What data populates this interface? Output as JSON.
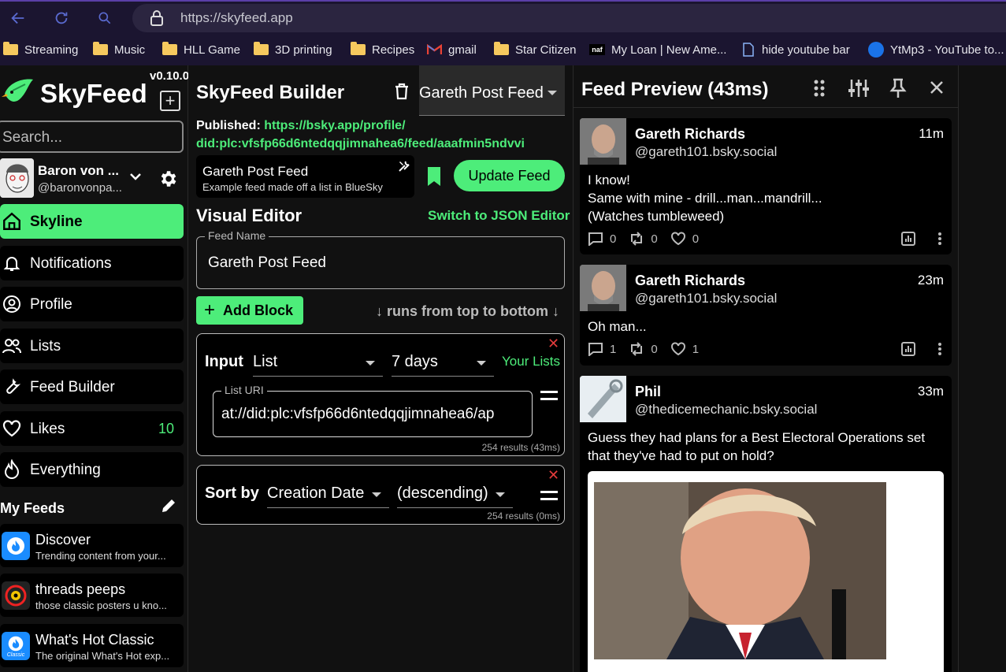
{
  "browser": {
    "url": "https://skyfeed.app",
    "bookmarks": [
      "Streaming",
      "Music",
      "HLL Game",
      "3D printing",
      "Recipes",
      "gmail",
      "Star Citizen",
      "My Loan | New Ame...",
      "hide youtube bar",
      "YtMp3 - YouTube to..."
    ]
  },
  "sidebar": {
    "app_name": "SkyFeed",
    "version": "v0.10.0",
    "search_placeholder": "Search...",
    "user": {
      "name": "Baron von ...",
      "handle": "@baronvonpa..."
    },
    "nav": [
      {
        "label": "Skyline",
        "icon": "home-icon"
      },
      {
        "label": "Notifications",
        "icon": "bell-icon"
      },
      {
        "label": "Profile",
        "icon": "user-circle-icon"
      },
      {
        "label": "Lists",
        "icon": "people-icon"
      },
      {
        "label": "Feed Builder",
        "icon": "wrench-icon"
      },
      {
        "label": "Likes",
        "icon": "heart-icon",
        "count": "10"
      },
      {
        "label": "Everything",
        "icon": "flame-icon"
      }
    ],
    "my_feeds_label": "My Feeds",
    "feeds": [
      {
        "title": "Discover",
        "subtitle": "Trending content from your..."
      },
      {
        "title": "threads peeps",
        "subtitle": "those classic posters u kno..."
      },
      {
        "title": "What's Hot Classic",
        "subtitle": "The original What's Hot exp...",
        "badge": "Classic"
      }
    ]
  },
  "builder": {
    "title": "SkyFeed Builder",
    "selected_feed": "Gareth Post Feed",
    "published_label": "Published:",
    "published_url_1": "https://bsky.app/profile/",
    "published_url_2": "did:plc:vfsfp66d6ntedqqjimnahea6/feed/aaafmin5ndvvi",
    "feed_card": {
      "name": "Gareth Post Feed",
      "description": "Example feed made off a list in BlueSky"
    },
    "update_label": "Update Feed",
    "visual_editor": "Visual Editor",
    "json_editor_link": "Switch to JSON Editor",
    "feed_name_legend": "Feed Name",
    "feed_name_value": "Gareth Post Feed",
    "add_block": "Add Block",
    "runs_hint": "↓ runs from top to bottom ↓",
    "input_block": {
      "label": "Input",
      "type": "List",
      "range": "7 days",
      "your_lists": "Your Lists",
      "list_uri_legend": "List URI",
      "list_uri_value": "at://did:plc:vfsfp66d6ntedqqjimnahea6/ap",
      "results": "254 results (43ms)"
    },
    "sort_block": {
      "label": "Sort by",
      "field": "Creation Date",
      "direction": "(descending)",
      "results": "254 results (0ms)"
    }
  },
  "preview": {
    "title": "Feed Preview (43ms)",
    "posts": [
      {
        "name": "Gareth Richards",
        "handle": "@gareth101.bsky.social",
        "time": "11m",
        "lines": [
          "I know!",
          "Same with mine - drill...man...mandrill...",
          "(Watches tumbleweed)"
        ],
        "replies": "0",
        "reposts": "0",
        "likes": "0"
      },
      {
        "name": "Gareth Richards",
        "handle": "@gareth101.bsky.social",
        "time": "23m",
        "lines": [
          "Oh man..."
        ],
        "replies": "1",
        "reposts": "0",
        "likes": "1"
      },
      {
        "name": "Phil",
        "handle": "@thedicemechanic.bsky.social",
        "time": "33m",
        "lines": [
          "Guess they had plans for a Best Electoral Operations set",
          "that they've had to put on hold?"
        ]
      }
    ]
  },
  "colors": {
    "accent": "#4ded7a",
    "danger": "#e23b3b",
    "bg": "#111111"
  }
}
